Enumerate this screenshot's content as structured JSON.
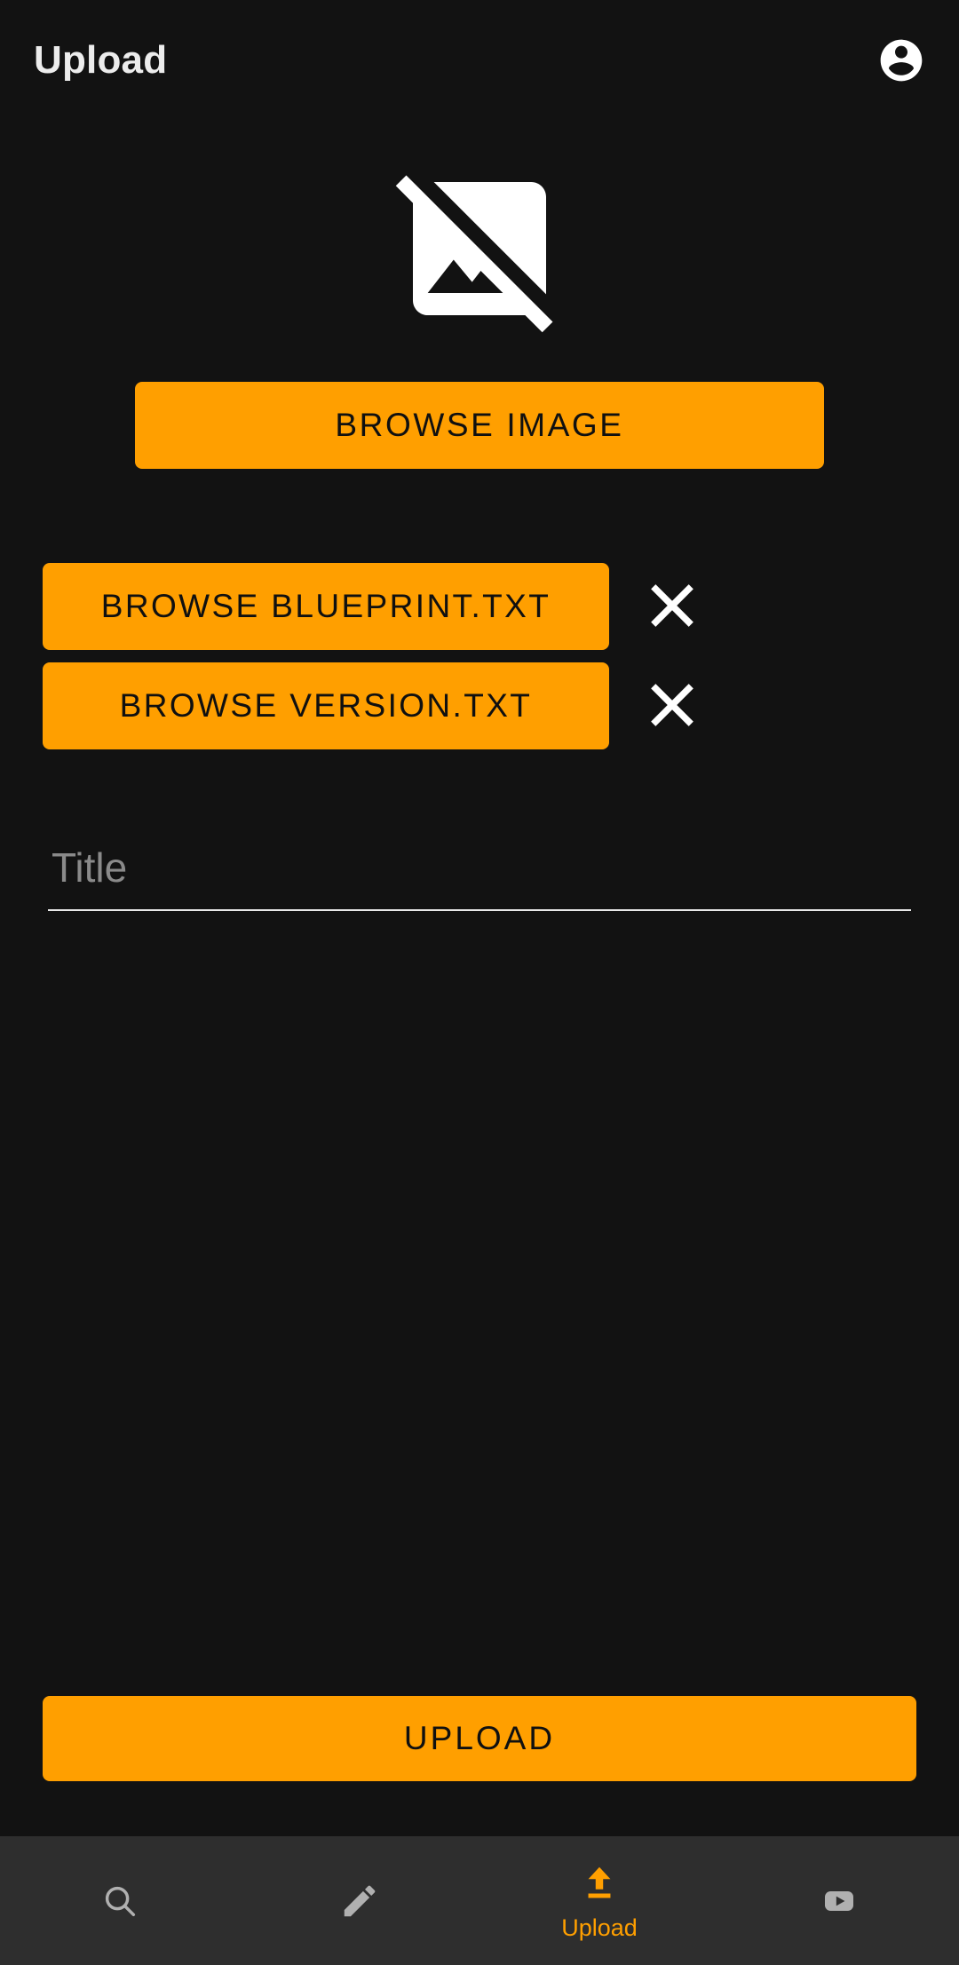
{
  "appbar": {
    "title": "Upload",
    "account_icon": "account-circle-icon"
  },
  "main": {
    "preview_icon": "broken-image-icon",
    "browse_image_label": "BROWSE IMAGE",
    "files": [
      {
        "browse_label": "BROWSE BLUEPRINT.TXT",
        "remove_icon": "close-icon"
      },
      {
        "browse_label": "BROWSE VERSION.TXT",
        "remove_icon": "close-icon"
      }
    ],
    "title_field": {
      "placeholder": "Title",
      "value": ""
    },
    "upload_label": "UPLOAD"
  },
  "bottom_nav": {
    "items": [
      {
        "icon": "search-icon",
        "label": "",
        "active": false
      },
      {
        "icon": "pencil-icon",
        "label": "",
        "active": false
      },
      {
        "icon": "upload-arrow-icon",
        "label": "Upload",
        "active": true
      },
      {
        "icon": "play-video-icon",
        "label": "",
        "active": false
      }
    ]
  },
  "colors": {
    "accent": "#FF9F00",
    "background": "#121212",
    "nav_background": "#2E2E2E",
    "on_accent": "#101010",
    "placeholder": "#8A8A8A",
    "icon_inactive": "#B0B0B0"
  }
}
